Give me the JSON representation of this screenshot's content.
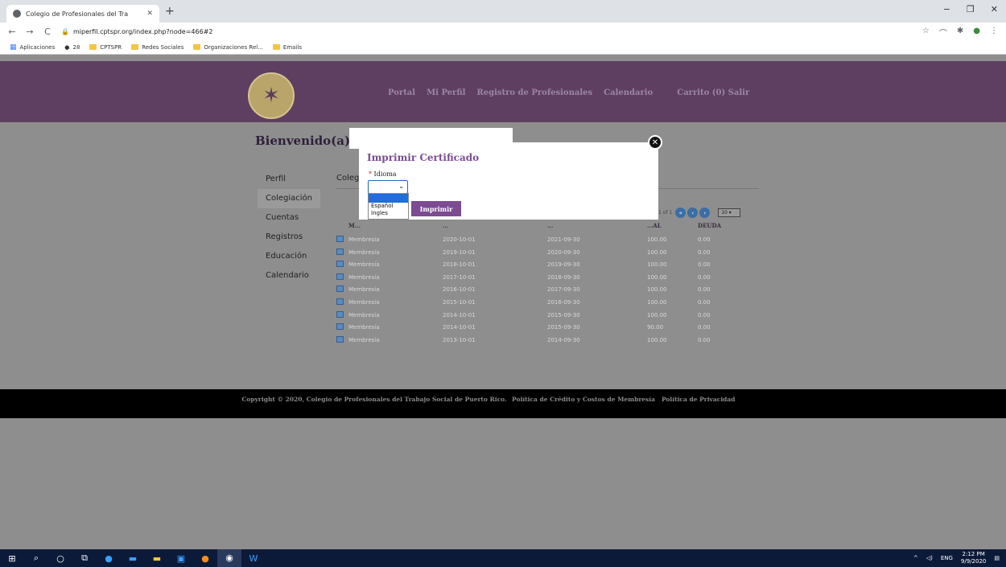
{
  "browser": {
    "tab_title": "Colegio de Profesionales del Tra",
    "tab_close": "✕",
    "new_tab": "+",
    "url": "miperfil.cptspr.org/index.php?node=466#2",
    "bookmarks": [
      "Aplicaciones",
      "28",
      "CPTSPR",
      "Redes Sociales",
      "Organizaciones Rel...",
      "Emails"
    ],
    "window_controls": [
      "−",
      "❐",
      "✕"
    ]
  },
  "header": {
    "nav": [
      "Portal",
      "Mi Perfil",
      "Registro de Profesionales",
      "Calendario"
    ],
    "cart": "Carrito (0) Salir"
  },
  "welcome": "Bienvenido(a)",
  "sidebar": {
    "items": [
      "Perfil",
      "Colegiación",
      "Cuentas",
      "Registros",
      "Educación",
      "Calendario"
    ]
  },
  "content": {
    "tab_label": "Coleg",
    "pager_text": "1 of 1",
    "page_size": "10",
    "columns": [
      "M...",
      "...",
      "...",
      "...AL",
      "DEUDA"
    ],
    "rows": [
      [
        "Membresía",
        "2020-10-01",
        "2021-09-30",
        "100.00",
        "0.00"
      ],
      [
        "Membresía",
        "2019-10-01",
        "2020-09-30",
        "100.00",
        "0.00"
      ],
      [
        "Membresía",
        "2018-10-01",
        "2019-09-30",
        "100.00",
        "0.00"
      ],
      [
        "Membresía",
        "2017-10-01",
        "2018-09-30",
        "100.00",
        "0.00"
      ],
      [
        "Membresía",
        "2016-10-01",
        "2017-09-30",
        "100.00",
        "0.00"
      ],
      [
        "Membresía",
        "2015-10-01",
        "2016-09-30",
        "100.00",
        "0.00"
      ],
      [
        "Membresía",
        "2014-10-01",
        "2015-09-30",
        "100.00",
        "0.00"
      ],
      [
        "Membresía",
        "2014-10-01",
        "2015-09-30",
        "90.00",
        "0.00"
      ],
      [
        "Membresía",
        "2013-10-01",
        "2014-09-30",
        "100.00",
        "0.00"
      ]
    ]
  },
  "footer": {
    "copyright": "Copyright © 2020, Colegio de Profesionales del Trabajo Social de Puerto Rico.",
    "links": [
      "Política de Crédito y Costos de Membresía",
      "Política de Privacidad"
    ]
  },
  "modal": {
    "title": "Imprimir Certificado",
    "required_mark": "*",
    "field_label": "Idioma",
    "select_value": "",
    "options": [
      "",
      "Español",
      "Ingles"
    ],
    "submit": "Imprimir"
  },
  "taskbar": {
    "tray_lang": "ENG",
    "time": "2:12 PM",
    "date": "9/9/2020"
  }
}
